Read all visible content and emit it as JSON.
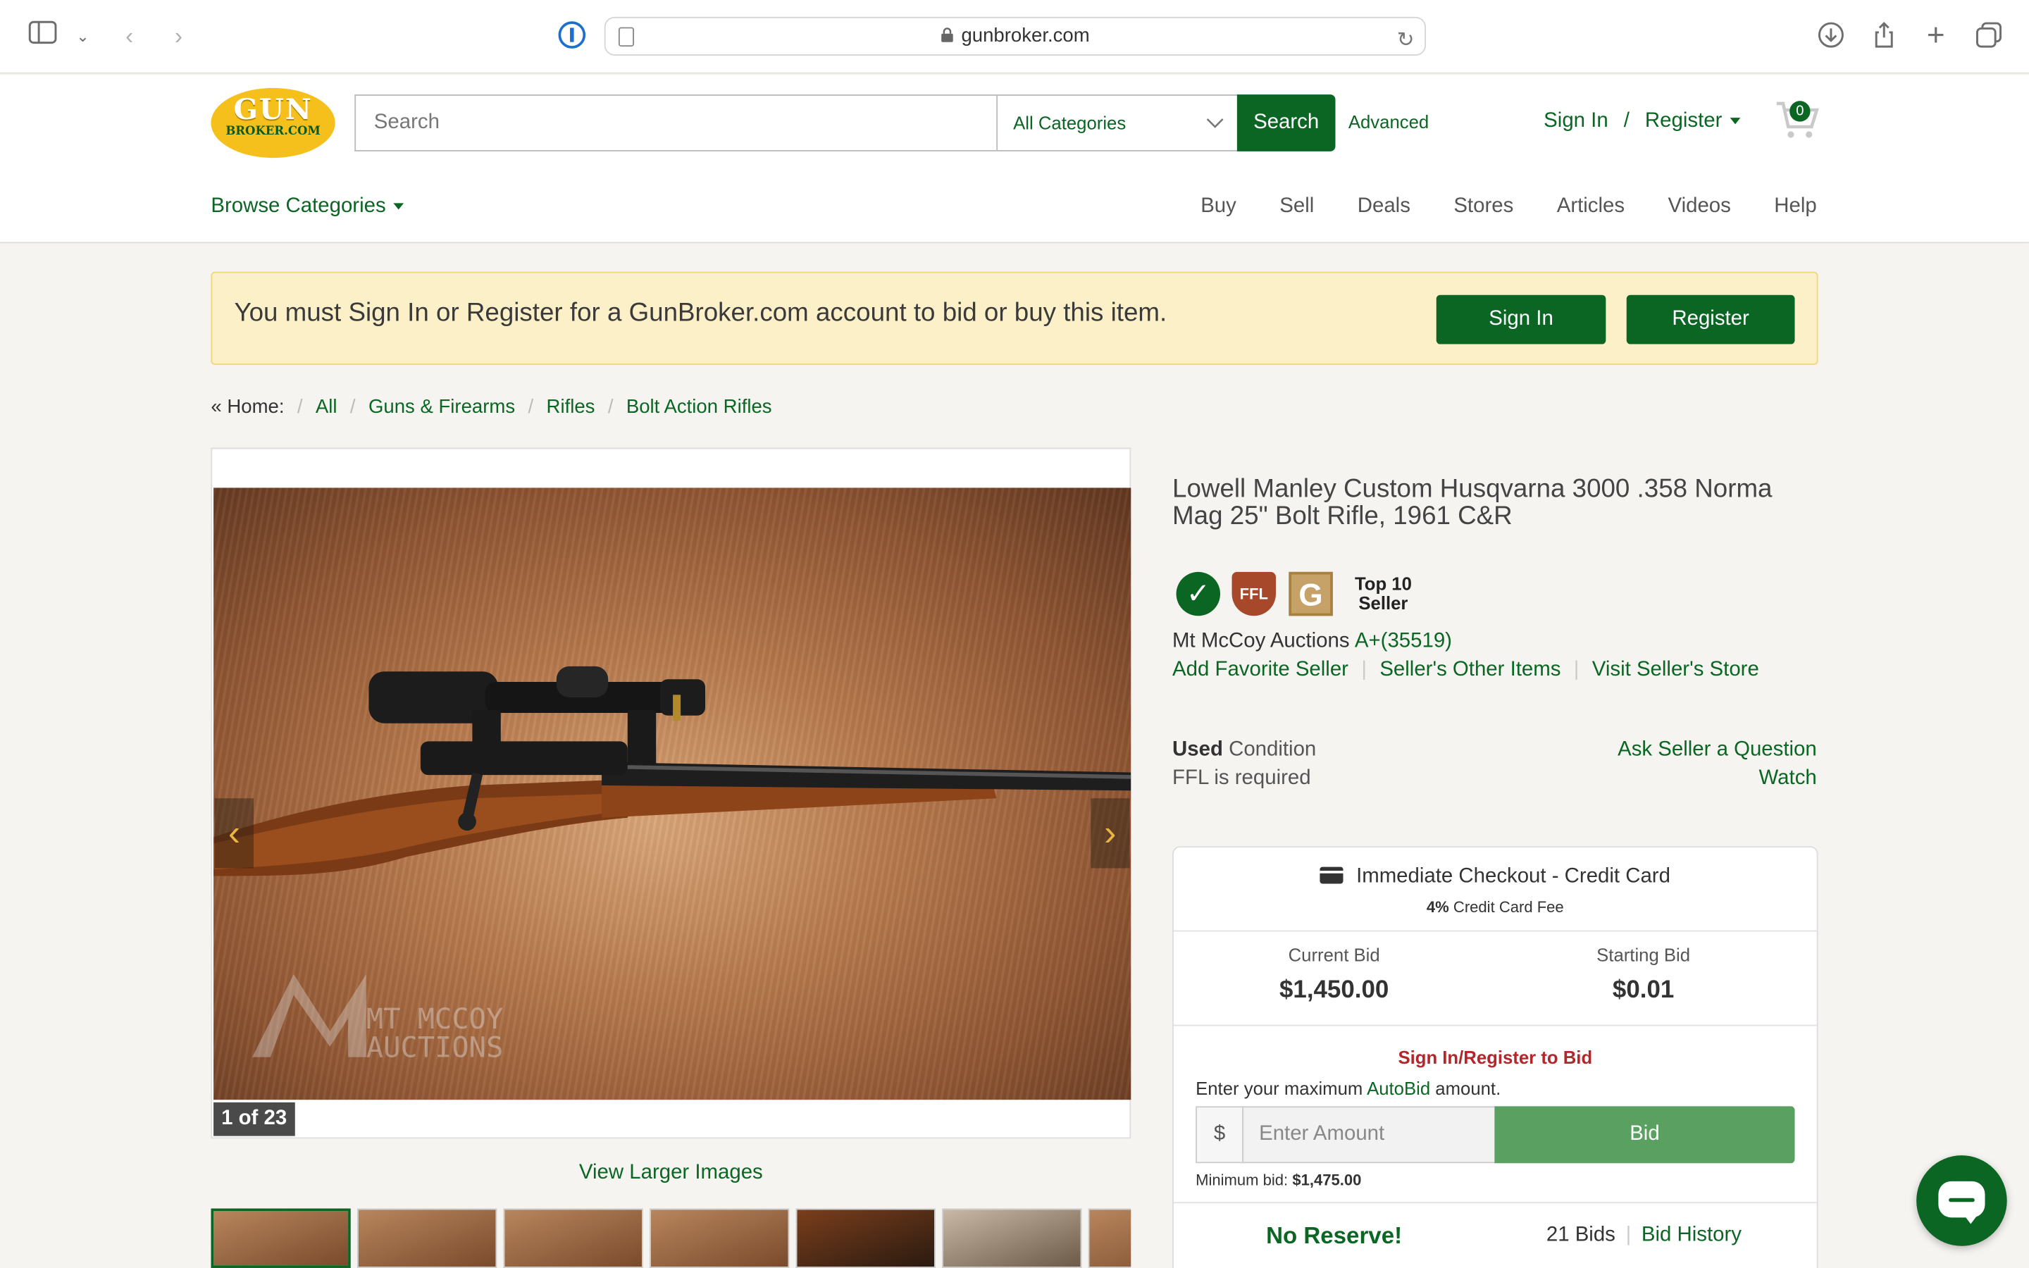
{
  "browser": {
    "url": "gunbroker.com"
  },
  "header": {
    "logo_line1": "GUN",
    "logo_line2": "BROKER.COM",
    "search_placeholder": "Search",
    "category": "All Categories",
    "search_button": "Search",
    "advanced": "Advanced",
    "sign_in": "Sign In",
    "slash": "/",
    "register": "Register",
    "cart_count": "0",
    "browse_categories": "Browse Categories",
    "nav": [
      "Buy",
      "Sell",
      "Deals",
      "Stores",
      "Articles",
      "Videos",
      "Help"
    ]
  },
  "alert": {
    "message": "You must Sign In or Register for a GunBroker.com account to bid or buy this item.",
    "sign_in_button": "Sign In",
    "register_button": "Register"
  },
  "breadcrumb": {
    "home": "« Home:",
    "items": [
      "All",
      "Guns & Firearms",
      "Rifles",
      "Bolt Action Rifles"
    ]
  },
  "gallery": {
    "counter": "1 of 23",
    "view_larger": "View Larger Images",
    "watermark_line1": "MT MCCOY",
    "watermark_line2": "AUCTIONS"
  },
  "item": {
    "title": "Lowell Manley Custom Husqvarna 3000 .358 Norma Mag 25\" Bolt Rifle, 1961 C&R",
    "badges": {
      "ffl": "FFL",
      "g": "G",
      "top10_line1": "Top 10",
      "top10_line2": "Seller"
    },
    "seller": "Mt McCoy Auctions",
    "rating": "A+(35519)",
    "seller_links": [
      "Add Favorite Seller",
      "Seller's Other Items",
      "Visit Seller's Store"
    ],
    "condition_value": "Used",
    "condition_label": "Condition",
    "ffl_note": "FFL is required",
    "ask_question": "Ask Seller a Question",
    "watch": "Watch"
  },
  "bid": {
    "checkout": "Immediate Checkout - Credit Card",
    "fee_percent": "4%",
    "fee_text": "Credit Card Fee",
    "current_bid_label": "Current Bid",
    "current_bid": "$1,450.00",
    "starting_bid_label": "Starting Bid",
    "starting_bid": "$0.01",
    "signin_to_bid": "Sign In/Register to Bid",
    "enter_max_prefix": "Enter your maximum",
    "autobid": "AutoBid",
    "enter_max_suffix": "amount.",
    "currency": "$",
    "amount_placeholder": "Enter Amount",
    "bid_button": "Bid",
    "min_bid_label": "Minimum bid:",
    "min_bid": "$1,475.00",
    "no_reserve": "No Reserve!",
    "bids": "21 Bids",
    "bid_history": "Bid History"
  },
  "colors": {
    "brand_green": "#0b6623",
    "logo_yellow": "#f6c01c",
    "alert_bg": "#fbf0c8",
    "error_red": "#b3262b"
  }
}
